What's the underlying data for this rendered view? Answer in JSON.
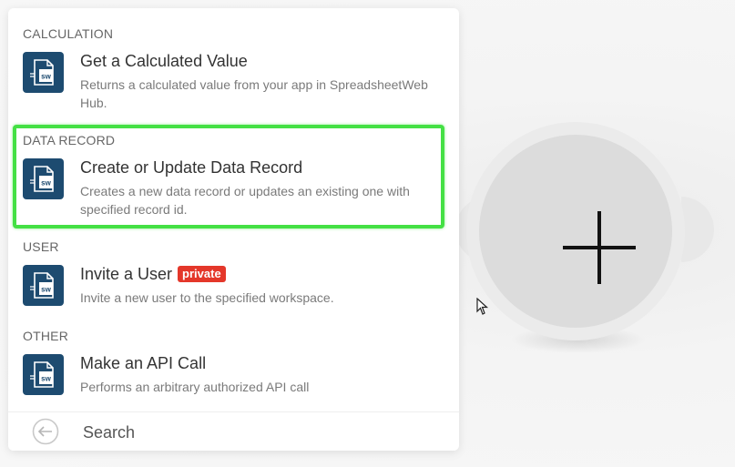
{
  "sections": {
    "calculation": "CALCULATION",
    "data_record": "DATA RECORD",
    "user": "USER",
    "other": "OTHER"
  },
  "items": [
    {
      "title": "Get a Calculated Value",
      "description": "Returns a calculated value from your app in SpreadsheetWeb Hub.",
      "icon": "spreadsheetweb-icon"
    },
    {
      "title": "Create or Update Data Record",
      "description": "Creates a new data record or updates an existing one with specified record id.",
      "icon": "spreadsheetweb-icon",
      "highlighted": true
    },
    {
      "title": "Invite a User",
      "badge": "private",
      "description": "Invite a new user to the specified workspace.",
      "icon": "spreadsheetweb-icon"
    },
    {
      "title": "Make an API Call",
      "description": "Performs an arbitrary authorized API call",
      "icon": "spreadsheetweb-icon"
    }
  ],
  "footer": {
    "search_label": "Search",
    "back_icon": "back-arrow-icon"
  },
  "colors": {
    "app_icon_bg": "#1d4b70",
    "highlight": "#44e044",
    "badge_bg": "#e4372a"
  },
  "add_module": {
    "icon": "plus-icon"
  }
}
